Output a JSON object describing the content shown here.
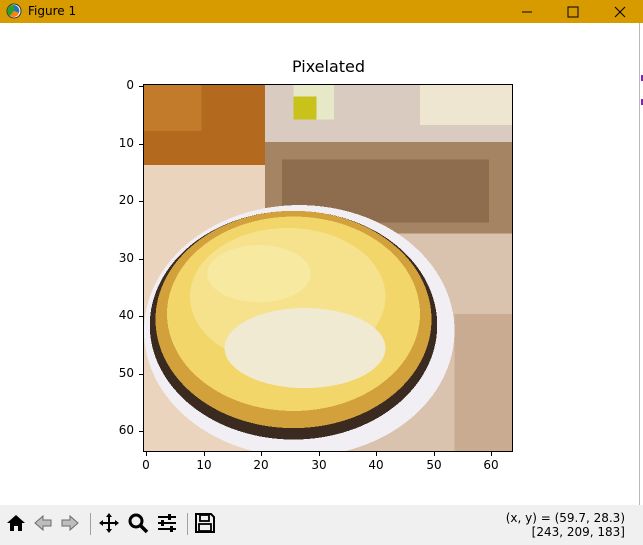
{
  "window": {
    "title": "Figure 1",
    "title_bar_color": "#d79b00",
    "icons": [
      "figure-app-icon",
      "minimize-icon",
      "maximize-icon",
      "close-icon"
    ]
  },
  "plot": {
    "title": "Pixelated",
    "y_ticks": [
      "0",
      "10",
      "20",
      "30",
      "40",
      "50",
      "60"
    ],
    "x_ticks": [
      "0",
      "10",
      "20",
      "30",
      "40",
      "50",
      "60"
    ],
    "image_size": [
      64,
      64
    ]
  },
  "toolbar": {
    "buttons": [
      "home-icon",
      "back-icon",
      "forward-icon",
      "pan-icon",
      "zoom-icon",
      "configure-subplots-icon",
      "save-icon"
    ]
  },
  "status": {
    "coords": "(x, y) = (59.7, 28.3)",
    "pixel": "[243, 209, 183]"
  }
}
